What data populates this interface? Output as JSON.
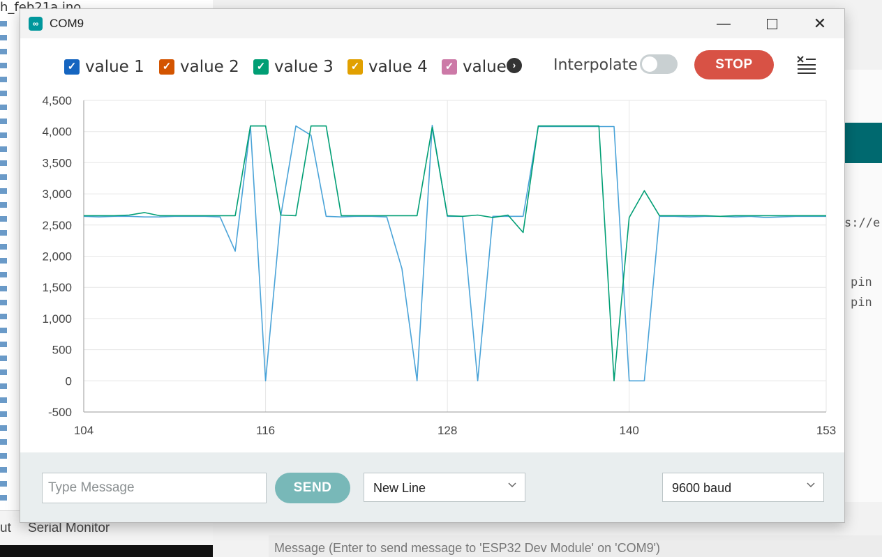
{
  "background": {
    "file_tab": "h_feb21a.ino",
    "bottom_left_labels": [
      "ut",
      "Serial Monitor"
    ],
    "code_lines": [
      "s://e",
      "pin",
      "pin"
    ],
    "message_bar": "Message (Enter to send message to 'ESP32 Dev Module' on 'COM9')"
  },
  "window": {
    "title": "COM9",
    "icon": "arduino-infinity-icon",
    "controls": {
      "minimize": "—",
      "maximize": "maximize-icon",
      "close": "✕"
    }
  },
  "toolbar": {
    "legend": [
      {
        "label": "value 1",
        "color": "#1565c0",
        "checked": true
      },
      {
        "label": "value 2",
        "color": "#d35400",
        "checked": true
      },
      {
        "label": "value 3",
        "color": "#009e74",
        "checked": true
      },
      {
        "label": "value 4",
        "color": "#e1a000",
        "checked": true
      },
      {
        "label": "value",
        "color": "#cc79a7",
        "checked": true
      }
    ],
    "more_icon": "chevron-right-icon",
    "interpolate_label": "Interpolate",
    "interpolate_on": false,
    "stop_label": "STOP",
    "clear_icon": "clear-output-icon"
  },
  "chart_data": {
    "type": "line",
    "xlim": [
      104,
      153
    ],
    "ylim": [
      -500,
      4500
    ],
    "x_ticks": [
      "104",
      "116",
      "128",
      "140",
      "153"
    ],
    "y_ticks": [
      "4,500",
      "4,000",
      "3,500",
      "3,000",
      "2,500",
      "2,000",
      "1,500",
      "1,000",
      "500",
      "0",
      "-500"
    ],
    "grid": true,
    "series": [
      {
        "color": "#4aa3d8",
        "points": [
          [
            104,
            2640
          ],
          [
            105,
            2630
          ],
          [
            106,
            2640
          ],
          [
            107,
            2640
          ],
          [
            108,
            2630
          ],
          [
            109,
            2630
          ],
          [
            110,
            2640
          ],
          [
            111,
            2640
          ],
          [
            112,
            2640
          ],
          [
            113,
            2630
          ],
          [
            114,
            2080
          ],
          [
            115,
            4090
          ],
          [
            116,
            0
          ],
          [
            117,
            2640
          ],
          [
            118,
            4090
          ],
          [
            119,
            3940
          ],
          [
            120,
            2640
          ],
          [
            121,
            2630
          ],
          [
            122,
            2640
          ],
          [
            123,
            2640
          ],
          [
            124,
            2630
          ],
          [
            125,
            1800
          ],
          [
            126,
            0
          ],
          [
            127,
            4100
          ],
          [
            128,
            2640
          ],
          [
            129,
            2640
          ],
          [
            130,
            0
          ],
          [
            131,
            2640
          ],
          [
            132,
            2640
          ],
          [
            133,
            2640
          ],
          [
            134,
            4080
          ],
          [
            135,
            4080
          ],
          [
            136,
            4080
          ],
          [
            137,
            4080
          ],
          [
            138,
            4080
          ],
          [
            139,
            4080
          ],
          [
            140,
            0
          ],
          [
            141,
            0
          ],
          [
            142,
            2640
          ],
          [
            143,
            2640
          ],
          [
            144,
            2630
          ],
          [
            145,
            2640
          ],
          [
            146,
            2640
          ],
          [
            147,
            2630
          ],
          [
            148,
            2640
          ],
          [
            149,
            2620
          ],
          [
            150,
            2630
          ],
          [
            151,
            2640
          ],
          [
            152,
            2640
          ],
          [
            153,
            2640
          ]
        ]
      },
      {
        "color": "#009e74",
        "points": [
          [
            104,
            2650
          ],
          [
            105,
            2650
          ],
          [
            106,
            2650
          ],
          [
            107,
            2660
          ],
          [
            108,
            2700
          ],
          [
            109,
            2650
          ],
          [
            110,
            2650
          ],
          [
            111,
            2650
          ],
          [
            112,
            2650
          ],
          [
            113,
            2650
          ],
          [
            114,
            2650
          ],
          [
            115,
            4090
          ],
          [
            116,
            4090
          ],
          [
            117,
            2660
          ],
          [
            118,
            2650
          ],
          [
            119,
            4090
          ],
          [
            120,
            4090
          ],
          [
            121,
            2650
          ],
          [
            122,
            2650
          ],
          [
            123,
            2650
          ],
          [
            124,
            2650
          ],
          [
            125,
            2650
          ],
          [
            126,
            2650
          ],
          [
            127,
            4070
          ],
          [
            128,
            2650
          ],
          [
            129,
            2640
          ],
          [
            130,
            2660
          ],
          [
            131,
            2620
          ],
          [
            132,
            2660
          ],
          [
            133,
            2380
          ],
          [
            134,
            4090
          ],
          [
            135,
            4090
          ],
          [
            136,
            4090
          ],
          [
            137,
            4090
          ],
          [
            138,
            4090
          ],
          [
            139,
            0
          ],
          [
            140,
            2620
          ],
          [
            141,
            3050
          ],
          [
            142,
            2650
          ],
          [
            143,
            2650
          ],
          [
            144,
            2650
          ],
          [
            145,
            2650
          ],
          [
            146,
            2640
          ],
          [
            147,
            2650
          ],
          [
            148,
            2650
          ],
          [
            149,
            2650
          ],
          [
            150,
            2650
          ],
          [
            151,
            2650
          ],
          [
            152,
            2650
          ],
          [
            153,
            2650
          ]
        ]
      }
    ]
  },
  "bottom": {
    "message_placeholder": "Type Message",
    "send_label": "SEND",
    "line_ending": "New Line",
    "baud": "9600 baud"
  }
}
